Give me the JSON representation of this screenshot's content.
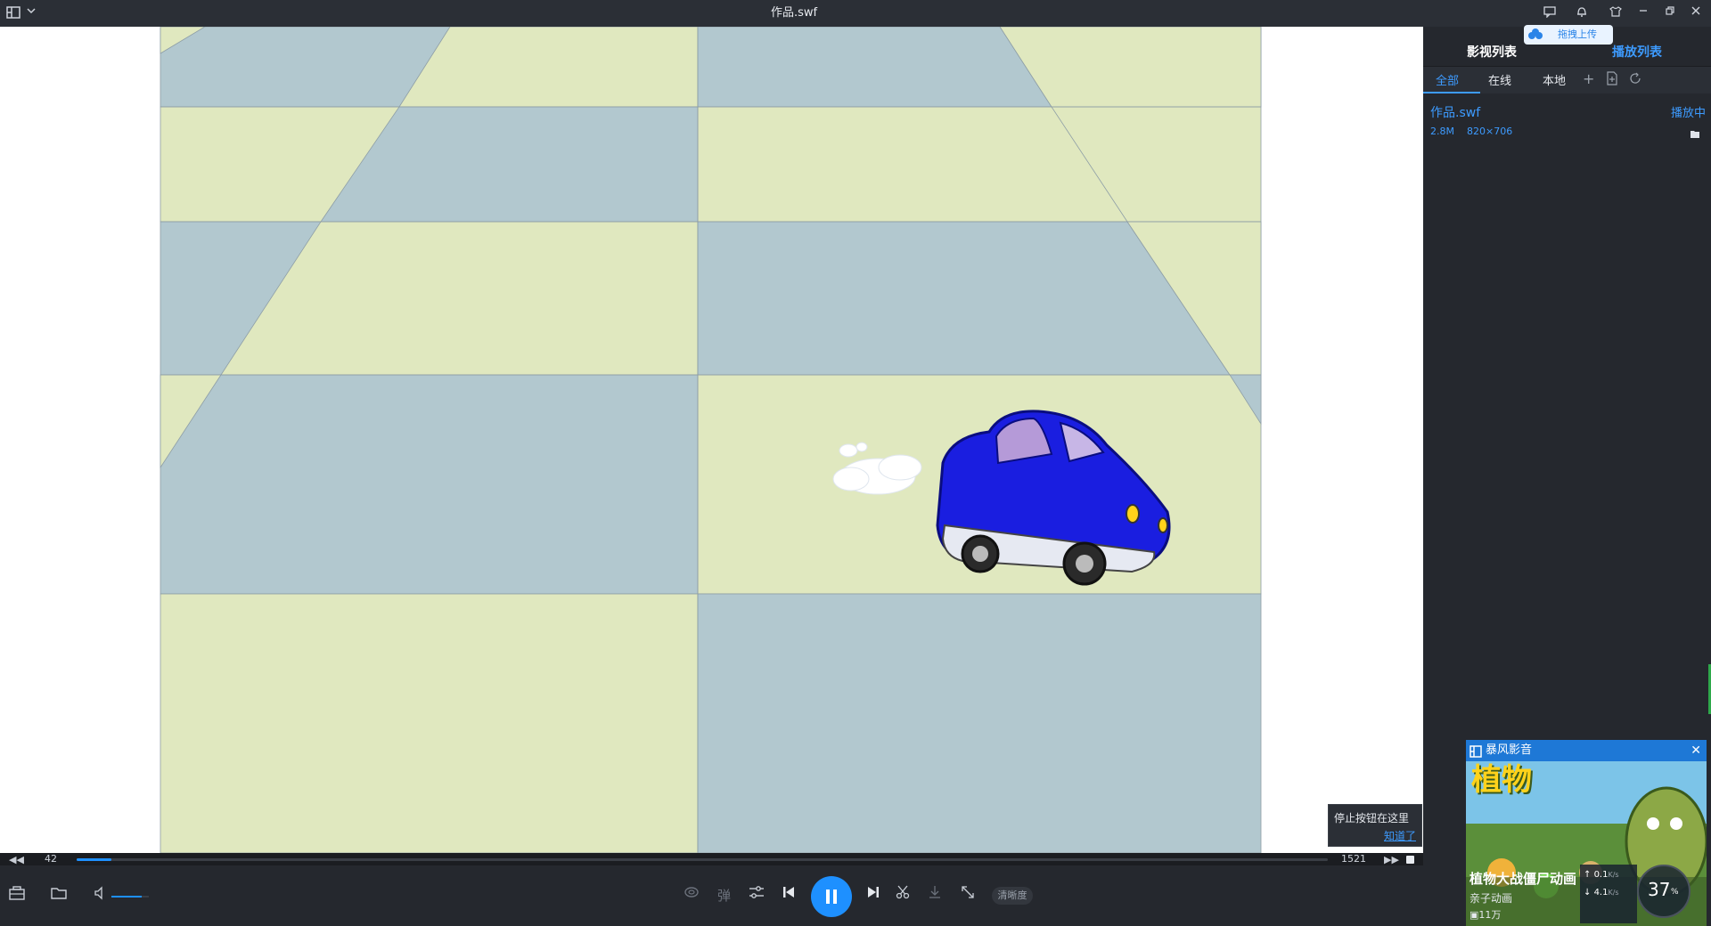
{
  "window": {
    "title": "作品.swf"
  },
  "titlebar": {
    "icons": [
      "menu-icon",
      "chevron-down-icon",
      "message-icon",
      "bell-icon",
      "skin-icon",
      "minimize-icon",
      "restore-icon",
      "close-icon"
    ]
  },
  "video": {
    "tip_text": "停止按钮在这里",
    "tip_link": "知道了"
  },
  "progress": {
    "current": "42",
    "total": "1521",
    "played_fraction": 0.028
  },
  "controls": {
    "danmu_label": "弹",
    "quality_label": "清晰度",
    "volume_fraction": 0.8,
    "accent": "#1e90ff"
  },
  "panel": {
    "upload_tip": "拖拽上传",
    "tabs": [
      "影视列表",
      "播放列表"
    ],
    "subtabs": [
      "全部",
      "在线",
      "本地"
    ],
    "item": {
      "name": "作品.swf",
      "status": "播放中",
      "size": "2.8M",
      "resolution": "820×706"
    }
  },
  "ad": {
    "brand": "暴风影音",
    "title": "植物大战僵尸动画",
    "subtitle": "亲子动画",
    "views": "11万",
    "net_up": "0.1",
    "net_down": "4.1",
    "net_unit": "K/s",
    "percent": "37",
    "percent_sign": "%"
  }
}
